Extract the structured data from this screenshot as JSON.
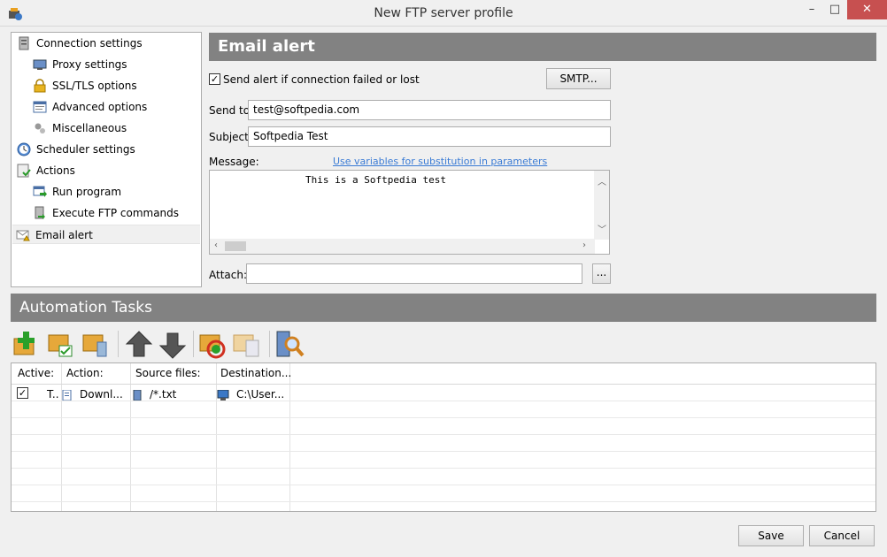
{
  "window": {
    "title": "New FTP server profile",
    "minimize": "–",
    "maximize": "□",
    "close": "✕"
  },
  "tree": {
    "items": [
      {
        "label": "Connection settings",
        "icon": "server-icon"
      },
      {
        "label": "Proxy settings",
        "icon": "proxy-icon"
      },
      {
        "label": "SSL/TLS options",
        "icon": "lock-icon"
      },
      {
        "label": "Advanced options",
        "icon": "advanced-icon"
      },
      {
        "label": "Miscellaneous",
        "icon": "gears-icon"
      },
      {
        "label": "Scheduler settings",
        "icon": "clock-icon"
      },
      {
        "label": "Actions",
        "icon": "actions-icon"
      },
      {
        "label": "Run program",
        "icon": "run-icon"
      },
      {
        "label": "Execute FTP commands",
        "icon": "ftp-commands-icon"
      },
      {
        "label": "Email alert",
        "icon": "email-alert-icon"
      }
    ]
  },
  "email_alert": {
    "header": "Email alert",
    "send_alert_label": "Send alert if connection failed or lost",
    "send_alert_checked": true,
    "smtp_button": "SMTP...",
    "send_to_label": "Send to:",
    "send_to_value": "test@softpedia.com",
    "subject_label": "Subject:",
    "subject_value": "Softpedia Test",
    "message_label": "Message:",
    "variables_link": "Use variables for substitution in parameters",
    "message_value": "This is a Softpedia test",
    "attach_label": "Attach:",
    "attach_value": "",
    "browse_button": "..."
  },
  "automation": {
    "header": "Automation Tasks",
    "toolbar": [
      "add-task-icon",
      "edit-task-icon",
      "copy-task-icon",
      "move-up-icon",
      "move-down-icon",
      "refresh-icon",
      "disable-icon",
      "search-icon"
    ],
    "columns": [
      "Active:",
      "Action:",
      "Source files:",
      "Destination..."
    ],
    "rows": [
      {
        "active": true,
        "type": "T..",
        "action": "Downl...",
        "source": "/*.txt",
        "destination": "C:\\User..."
      }
    ]
  },
  "footer": {
    "save": "Save",
    "cancel": "Cancel"
  }
}
